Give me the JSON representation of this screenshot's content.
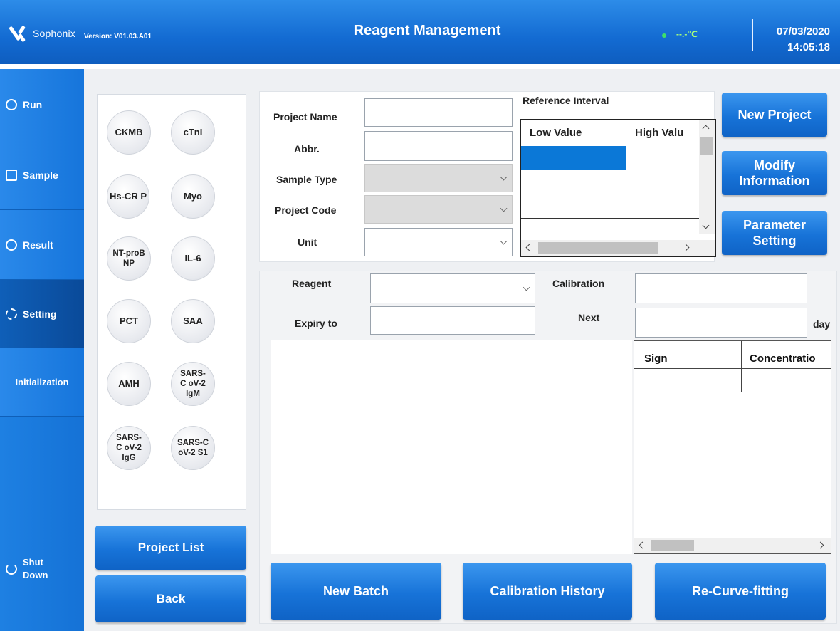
{
  "header": {
    "brand": "Sophonix",
    "version": "Version: V01.03.A01",
    "title": "Reagent Management",
    "temperature": "--.-℃",
    "date": "07/03/2020",
    "time": "14:05:18",
    "colors": {
      "header": "#136bd2",
      "temp_dot": "#3ee06a"
    }
  },
  "nav": {
    "items": [
      {
        "label": "Run",
        "icon": "play-circle-icon"
      },
      {
        "label": "Sample",
        "icon": "sample-list-icon"
      },
      {
        "label": "Result",
        "icon": "search-icon"
      },
      {
        "label": "Setting",
        "icon": "gear-icon",
        "active": true
      },
      {
        "label": "Initialization"
      },
      {
        "label": "Shut Down",
        "icon": "power-icon"
      }
    ]
  },
  "projects": {
    "chips": [
      "CKMB",
      "cTnI",
      "Hs-CR P",
      "Myo",
      "NT-proB NP",
      "IL-6",
      "PCT",
      "SAA",
      "AMH",
      "SARS-C oV-2 IgM",
      "SARS-C oV-2 IgG",
      "SARS-C oV-2 S1"
    ],
    "project_list_button": "Project List",
    "back_button": "Back"
  },
  "form": {
    "project_name_label": "Project Name",
    "project_name_value": "",
    "abbr_label": "Abbr.",
    "abbr_value": "",
    "sample_type_label": "Sample Type",
    "sample_type_value": "",
    "project_code_label": "Project Code",
    "project_code_value": "",
    "unit_label": "Unit",
    "unit_value": ""
  },
  "reference_interval": {
    "title": "Reference Interval",
    "columns": [
      "Low Value",
      "High Valu"
    ],
    "rows": [
      [
        "",
        ""
      ],
      [
        "",
        ""
      ],
      [
        "",
        ""
      ],
      [
        "",
        ""
      ]
    ],
    "selected_cell": "0.0"
  },
  "actions": {
    "new_project": "New Project",
    "modify_information": "Modify Information",
    "parameter_setting": "Parameter Setting"
  },
  "reagent": {
    "reagent_label": "Reagent",
    "reagent_value": "",
    "expiry_label": "Expiry to",
    "expiry_value": "",
    "calibration_label": "Calibration",
    "calibration_value": "",
    "next_label": "Next",
    "next_value": "",
    "next_unit": "day"
  },
  "calibration_table": {
    "columns": [
      "Sign",
      "Concentratio"
    ],
    "rows": [
      [
        "",
        ""
      ]
    ]
  },
  "bottom_buttons": {
    "new_batch": "New Batch",
    "calibration_history": "Calibration History",
    "re_curve_fitting": "Re-Curve-fitting"
  }
}
